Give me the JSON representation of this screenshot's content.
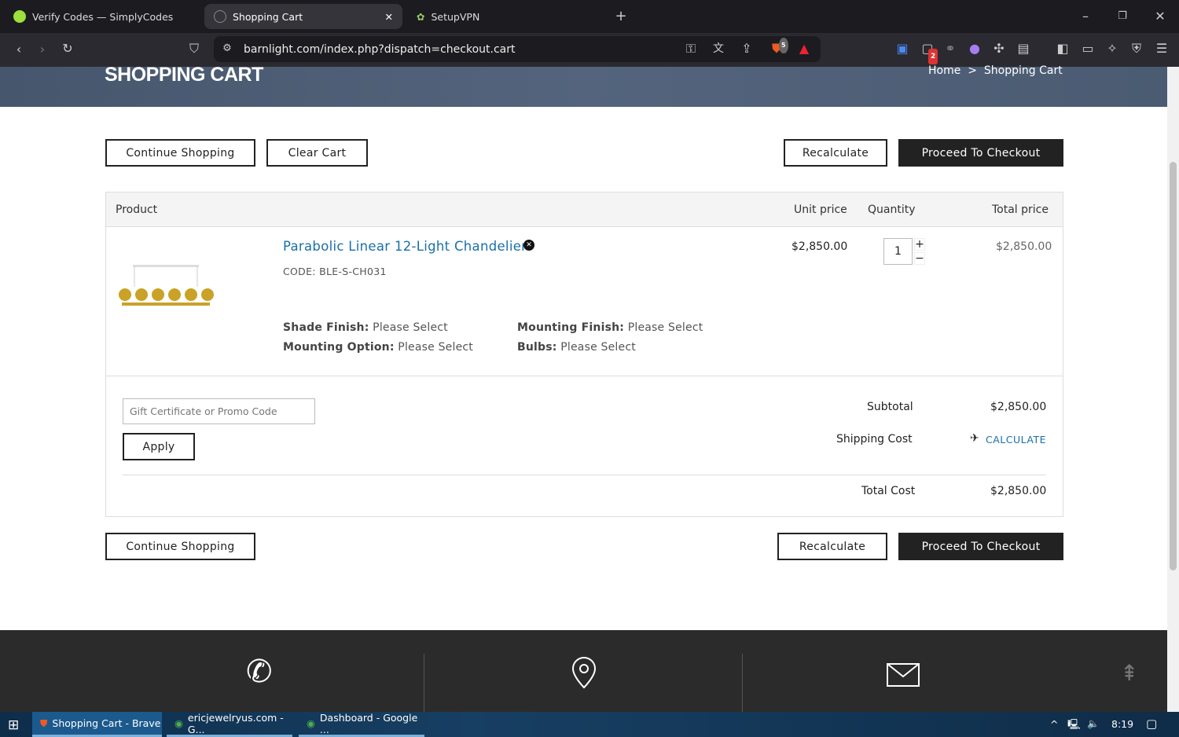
{
  "browser": {
    "tabs": [
      {
        "label": "Verify Codes — SimplyCodes"
      },
      {
        "label": "Shopping Cart",
        "active": true
      },
      {
        "label": "SetupVPN"
      }
    ],
    "url": "barnlight.com/index.php?dispatch=checkout.cart",
    "brave_badge": "5",
    "ext_badge": "2"
  },
  "page": {
    "title": "SHOPPING CART",
    "breadcrumb": {
      "home": "Home",
      "sep": ">",
      "current": "Shopping Cart"
    },
    "buttons": {
      "continue": "Continue Shopping",
      "clear": "Clear Cart",
      "recalculate": "Recalculate",
      "checkout": "Proceed To Checkout",
      "apply": "Apply"
    },
    "table": {
      "headers": [
        "Product",
        "Unit price",
        "Quantity",
        "Total price"
      ]
    },
    "item": {
      "name": "Parabolic Linear 12-Light Chandelier",
      "code": "CODE: BLE-S-CH031",
      "unit_price": "$2,850.00",
      "quantity": "1",
      "total": "$2,850.00",
      "options": [
        {
          "label": "Shade Finish:",
          "value": "Please Select"
        },
        {
          "label": "Mounting Finish:",
          "value": "Please Select"
        },
        {
          "label": "Mounting Option:",
          "value": "Please Select"
        },
        {
          "label": "Bulbs:",
          "value": "Please Select"
        }
      ]
    },
    "promo": {
      "placeholder": "Gift Certificate or Promo Code"
    },
    "summary": {
      "subtotal_label": "Subtotal",
      "subtotal": "$2,850.00",
      "shipping_label": "Shipping Cost",
      "shipping_action": "CALCULATE",
      "total_label": "Total Cost",
      "total": "$2,850.00"
    },
    "link_color": "#1a6fa8"
  },
  "taskbar": {
    "items": [
      "Shopping Cart - Brave",
      "ericjewelryus.com - G...",
      "Dashboard - Google ..."
    ],
    "time": "8:19"
  }
}
